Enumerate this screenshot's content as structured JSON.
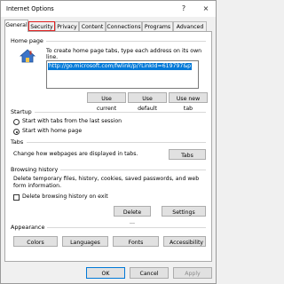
{
  "window": {
    "title": "Internet Options",
    "help_label": "?",
    "close_label": "×"
  },
  "tabs": [
    {
      "label": "General"
    },
    {
      "label": "Security"
    },
    {
      "label": "Privacy"
    },
    {
      "label": "Content"
    },
    {
      "label": "Connections"
    },
    {
      "label": "Programs"
    },
    {
      "label": "Advanced"
    }
  ],
  "home_page": {
    "group_label": "Home page",
    "instruction_line1": "To create home page tabs, type each address on its own",
    "instruction_line2": "line.",
    "url_value": "http://go.microsoft.com/fwlink/p/?LinkId=619797&p",
    "use_current": "Use current",
    "use_default": "Use default",
    "use_new_tab": "Use new tab"
  },
  "startup": {
    "group_label": "Startup",
    "option1": "Start with tabs from the last session",
    "option2": "Start with home page"
  },
  "tabs_group": {
    "group_label": "Tabs",
    "description": "Change how webpages are displayed in tabs.",
    "button": "Tabs"
  },
  "browsing_history": {
    "group_label": "Browsing history",
    "line1": "Delete temporary files, history, cookies, saved passwords, and web",
    "line2": "form information.",
    "checkbox_label": "Delete browsing history on exit",
    "delete_button": "Delete ...",
    "settings_button": "Settings"
  },
  "appearance": {
    "group_label": "Appearance",
    "colors": "Colors",
    "languages": "Languages",
    "fonts": "Fonts",
    "accessibility": "Accessibility"
  },
  "footer": {
    "ok": "OK",
    "cancel": "Cancel",
    "apply": "Apply"
  }
}
